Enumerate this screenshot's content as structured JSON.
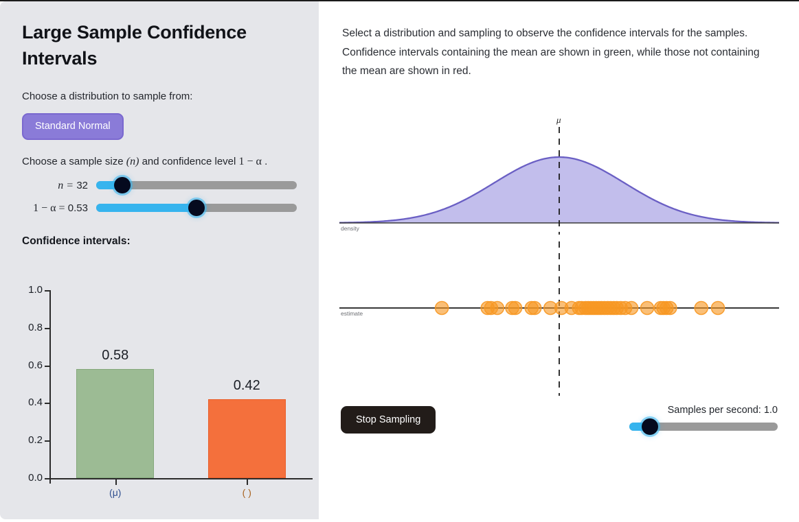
{
  "sidebar": {
    "title": "Large Sample Confidence Intervals",
    "distribution_prompt": "Choose a distribution to sample from:",
    "distribution_button": "Standard Normal",
    "params_prompt_pre": "Choose a sample size ",
    "params_prompt_n": "(n)",
    "params_prompt_mid": " and confidence level ",
    "params_prompt_alpha": "1 − α",
    "params_prompt_post": " .",
    "sliders": [
      {
        "label_math": "n =",
        "value": "32",
        "fill_percent": 13,
        "knob_percent": 13
      },
      {
        "label_math": "1 − α =",
        "value": "0.53",
        "fill_percent": 50,
        "knob_percent": 50
      }
    ],
    "ci_heading": "Confidence intervals:"
  },
  "main": {
    "intro": "Select a distribution and sampling to observe the confidence intervals for the samples. Confidence intervals containing the mean are shown in green, while those not containing the mean are shown in red.",
    "density_axis_name": "density",
    "estimate_axis_name": "estimate",
    "mu_label": "μ",
    "stop_button": "Stop Sampling",
    "samples_per_second_label": "Samples per second: 1.0",
    "samples_per_second_fill_percent": 14,
    "samples_per_second_knob_percent": 14
  },
  "colors": {
    "sidebar_bg": "#e5e6ea",
    "accent_purple": "#8a7bd8",
    "slider_blue": "#36b4ee",
    "bar_green": "#9cbb94",
    "bar_green_border": "#84a87b",
    "bar_red": "#f4703c",
    "bar_red_border": "#e85f2b",
    "dot_orange": "#f79824",
    "density_fill": "#9c96e0",
    "density_stroke": "#6a5fc4",
    "button_dark": "#221c19"
  },
  "chart_data": {
    "type": "bar",
    "title": "Confidence intervals:",
    "categories": [
      "(μ)",
      "( )"
    ],
    "values": [
      0.58,
      0.42
    ],
    "value_labels": [
      "0.58",
      "0.42"
    ],
    "bar_colors": [
      "#9cbb94",
      "#f4703c"
    ],
    "ylabel": "",
    "xlabel": "",
    "ylim": [
      0.0,
      1.0
    ],
    "yticks": [
      1.0,
      0.8,
      0.6,
      0.4,
      0.2,
      0.0
    ],
    "ytick_labels": [
      "1.0",
      "0.8",
      "0.6",
      "0.4",
      "0.2",
      "0.0"
    ],
    "grid": false,
    "legend": "none"
  },
  "density_chart": {
    "type": "area",
    "label": "density",
    "mean_marker": "μ",
    "distribution": "standard normal",
    "mean_x_fraction": 0.5
  },
  "estimate_chart": {
    "type": "scatter",
    "label": "estimate",
    "point_color": "#f79824",
    "x_fractions": [
      0.233,
      0.337,
      0.345,
      0.359,
      0.393,
      0.4,
      0.437,
      0.444,
      0.48,
      0.505,
      0.528,
      0.545,
      0.551,
      0.56,
      0.566,
      0.572,
      0.578,
      0.584,
      0.59,
      0.596,
      0.603,
      0.61,
      0.617,
      0.624,
      0.631,
      0.64,
      0.65,
      0.664,
      0.7,
      0.731,
      0.737,
      0.744,
      0.752,
      0.823,
      0.861
    ]
  }
}
